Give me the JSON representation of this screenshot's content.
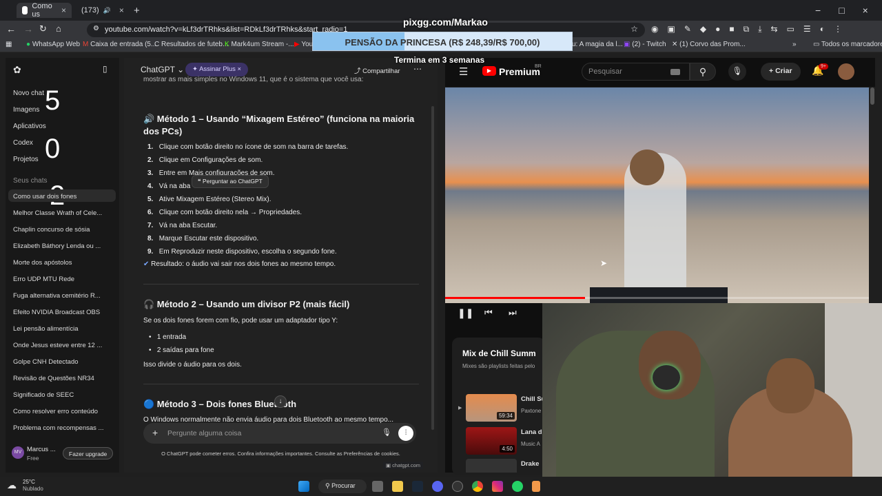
{
  "browser": {
    "tabs": [
      {
        "label": "Como us"
      },
      {
        "label": "(173)"
      }
    ],
    "url": "youtube.com/watch?v=kLf3drTRhks&list=RDkLf3drTRhks&start_radio=1",
    "bookmarks": [
      "WhatsApp Web",
      "Caixa de entrada (5...",
      "Resultados de futeb...",
      "Mark4um Stream -...",
      "You",
      "u: A magia da l...",
      "(2) - Twitch",
      "(1) Corvo das Prom...",
      "Todos os marcadores"
    ]
  },
  "overlay": {
    "title": "pixgg.com/Markao",
    "goal_text": "PENSÃO DA PRINCESA (R$ 248,39/R$ 700,00)",
    "goal_progress": 0.355,
    "subtitle": "Termina em 3 semanas",
    "countdown": [
      "5",
      "0",
      "2"
    ]
  },
  "chatgpt": {
    "model_label": "ChatGPT",
    "upgrade_label": "Assinar Plus",
    "share_label": "Compartilhar",
    "menu": [
      "Novo chat",
      "Imagens",
      "Aplicativos",
      "Codex",
      "Projetos"
    ],
    "section_label": "Seus chats",
    "chats": [
      "Como usar dois fones",
      "Melhor Classe Wrath of Cele...",
      "Chaplin concurso de sósia",
      "Elizabeth Báthory Lenda ou ...",
      "Morte dos apóstolos",
      "Erro UDP MTU Rede",
      "Fuga alternativa cemitério R...",
      "Efeito NVIDIA Broadcast OBS",
      "Lei pensão alimentícia",
      "Onde Jesus esteve entre 12 ...",
      "Golpe CNH Detectado",
      "Revisão de Questões NR34",
      "Significado de SEEC",
      "Como resolver erro conteúdo",
      "Problema com recompensas ..."
    ],
    "user_name": "Marcus ...",
    "user_plan": "Free",
    "user_initials": "MV",
    "upgrade_button": "Fazer upgrade",
    "intro_text": "mostrar as mais simples no Windows 11, que é o sistema que você usa:",
    "method1_title": "🔊 Método 1 – Usando “Mixagem Estéreo” (funciona na maioria dos PCs)",
    "method1_steps": [
      "Clique com botão direito no ícone de som na barra de tarefas.",
      "Clique em Configurações de som.",
      "Entre em Mais configurações de som.",
      "Vá na aba",
      "Ative Mixagem Estéreo (Stereo Mix).",
      "Clique com botão direito nela → Propriedades.",
      "Vá na aba Escutar.",
      "Marque Escutar este dispositivo.",
      "Em Reproduzir neste dispositivo, escolha o segundo fone."
    ],
    "tooltip": "Perguntar ao ChatGPT",
    "method1_result": "Resultado: o áudio vai sair nos dois fones ao mesmo tempo.",
    "method2_title": "🎧 Método 2 – Usando um divisor P2 (mais fácil)",
    "method2_text": "Se os dois fones forem com fio, pode usar um adaptador tipo Y:",
    "method2_bullets": [
      "1 entrada",
      "2 saídas para fone"
    ],
    "method2_footer": "Isso divide o áudio para os dois.",
    "method3_title": "🔵 Método 3 – Dois fones Bluetooth",
    "method3_text": "O Windows normalmente não envia áudio para dois Bluetooth ao mesmo tempo...",
    "input_placeholder": "Pergunte alguma coisa",
    "disclaimer": "O ChatGPT pode cometer erros. Confira informações importantes. Consulte as Preferências de cookies."
  },
  "youtube": {
    "logo": "Premium",
    "region": "BR",
    "search_placeholder": "Pesquisar",
    "create_label": "Criar",
    "notif_count": "9+",
    "playlist_title": "Mix de Chill Summ",
    "playlist_sub": "Mixes são playlists feitas pelo",
    "items": [
      {
        "title": "Chill Su",
        "channel": "Paxtone",
        "duration": "59:34"
      },
      {
        "title": "Lana d",
        "channel": "Music A",
        "duration": "4:50"
      },
      {
        "title": "Drake",
        "channel": "",
        "duration": ""
      }
    ],
    "progress": 0.33,
    "status_url": "chatgpt.com"
  },
  "taskbar": {
    "temp": "25°C",
    "weather": "Nublado",
    "search_label": "Procurar"
  }
}
